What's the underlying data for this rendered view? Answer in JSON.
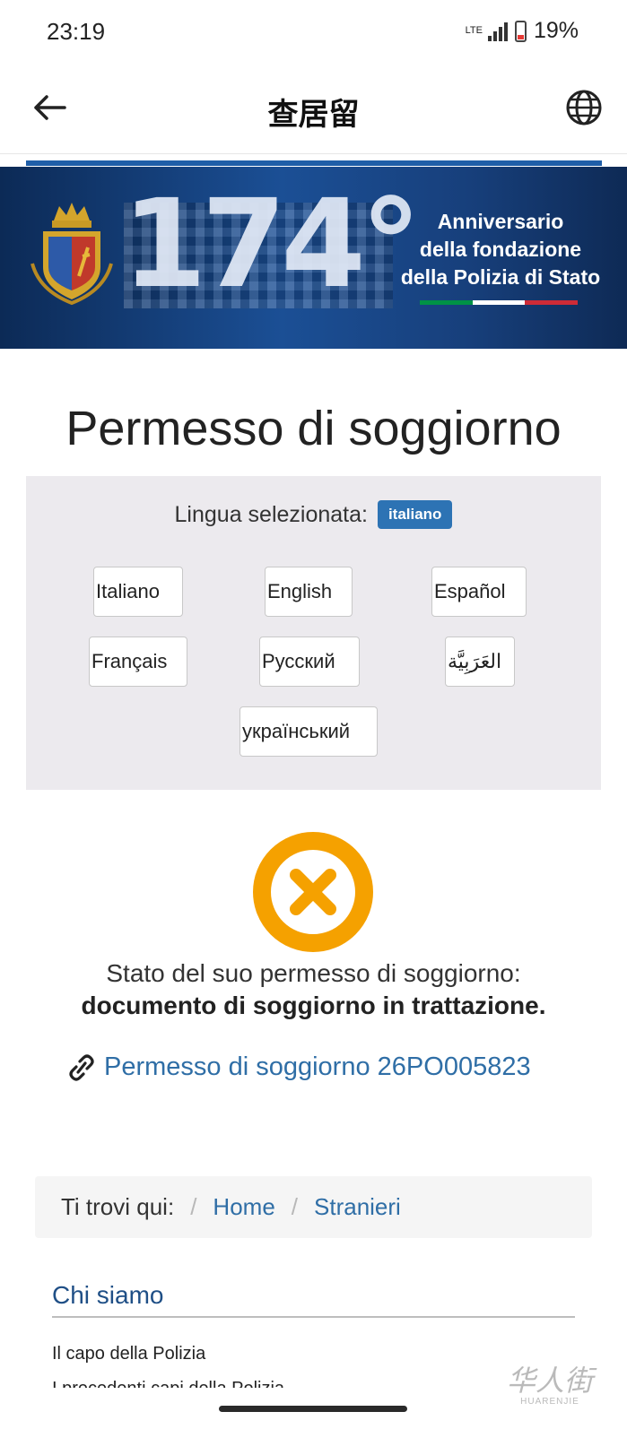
{
  "status_bar": {
    "time": "23:19",
    "network": "LTE",
    "battery": "19%"
  },
  "app_bar": {
    "title": "查居留"
  },
  "banner": {
    "number": "174°",
    "lines": [
      "Anniversario",
      "della fondazione",
      "della Polizia di Stato"
    ],
    "flag_colors": [
      "#009246",
      "#ffffff",
      "#ce2b37"
    ]
  },
  "page_title": "Permesso di soggiorno",
  "language": {
    "selected_label": "Lingua selezionata:",
    "selected_value": "italiano",
    "buttons": [
      "Italiano",
      "English",
      "Español",
      "Français",
      "Русский",
      "العَرَبِيَّة",
      "український"
    ]
  },
  "status": {
    "icon": "error-x-icon",
    "icon_color": "#f5a100",
    "label": "Stato del suo permesso di soggiorno:",
    "value": "documento di soggiorno in trattazione."
  },
  "permit_link": {
    "icon": "link-icon",
    "text": "Permesso di soggiorno 26PO005823"
  },
  "breadcrumb": {
    "label": "Ti trovi qui:",
    "separator": "/",
    "items": [
      "Home",
      "Stranieri"
    ]
  },
  "section": {
    "title": "Chi siamo",
    "items": [
      "Il capo della Polizia",
      "I precedenti capi della Polizia"
    ]
  },
  "watermark": {
    "cn": "华人街",
    "en": "HUARENJIE"
  },
  "colors": {
    "accent": "#2d73b4",
    "link": "#2f6ea6",
    "panel_bg": "#eceaee",
    "warning": "#f5a100"
  }
}
